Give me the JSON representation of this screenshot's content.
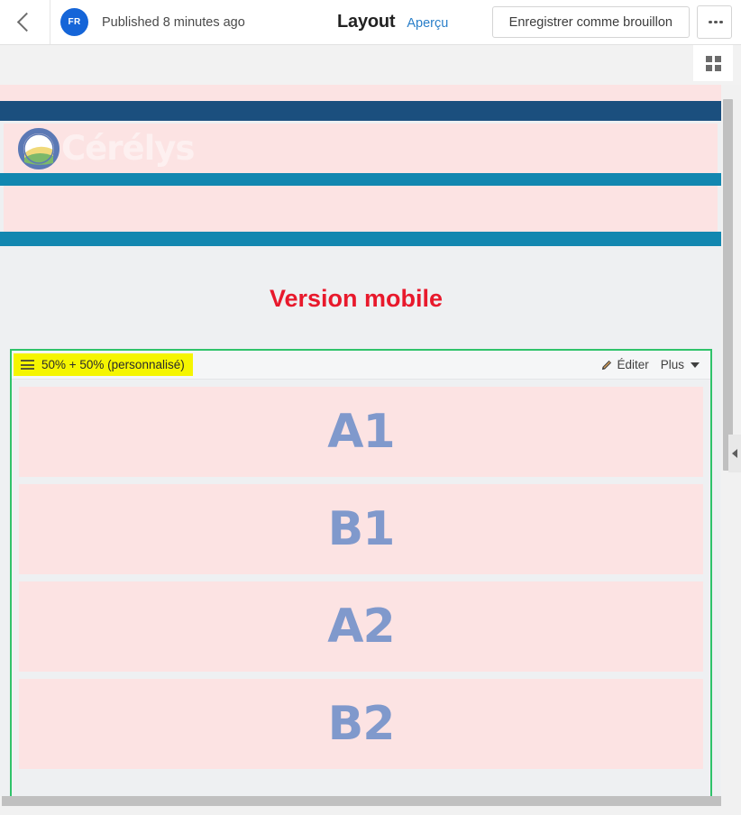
{
  "header": {
    "back_icon": "chevron-left-icon",
    "avatar_initials": "FR",
    "publish_status": "Published 8 minutes ago",
    "page_title": "Layout",
    "preview_label": "Aperçu",
    "save_draft_label": "Enregistrer comme brouillon",
    "more_icon": "ellipsis-icon",
    "grid_icon": "grid-view-icon"
  },
  "preview": {
    "logo_text": "Cérélys",
    "logo_icon": "cerelys-logo-icon",
    "version_heading": "Version mobile"
  },
  "section": {
    "layout_badge": "50% + 50% (personnalisé)",
    "burger_icon": "hamburger-icon",
    "edit_label": "Éditer",
    "edit_icon": "pencil-icon",
    "more_label": "Plus",
    "more_icon": "chevron-down-icon",
    "blocks": [
      {
        "label": "A1"
      },
      {
        "label": "B1"
      },
      {
        "label": "A2"
      },
      {
        "label": "B2"
      }
    ]
  },
  "colors": {
    "accent_blue": "#1565d8",
    "link_blue": "#2a7fc9",
    "site_navy": "#1b4f7e",
    "site_teal": "#1287b0",
    "block_pink": "#fce3e3",
    "block_label": "#8099cc",
    "heading_red": "#e8192c",
    "badge_yellow": "#f5f500",
    "selection_green": "#2fc36a"
  },
  "scroll": {
    "vertical_thumb": "vertical-scrollbar-thumb",
    "horizontal_thumb": "horizontal-scrollbar-thumb",
    "collapse_icon": "chevron-left-icon"
  }
}
